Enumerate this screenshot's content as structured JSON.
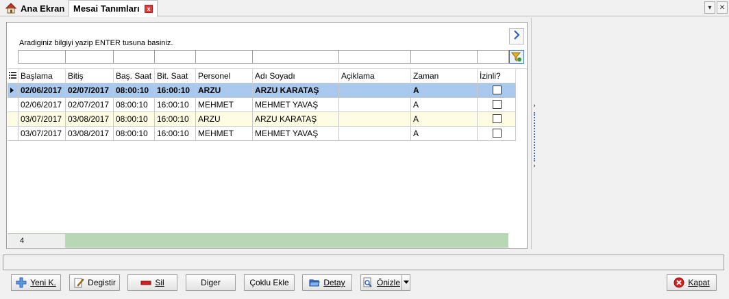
{
  "tabs": {
    "home_label": "Ana Ekran",
    "active_label": "Mesai Tanımları",
    "close_glyph": "x"
  },
  "window_controls": {
    "dropdown_glyph": "▾",
    "close_glyph": "✕"
  },
  "search": {
    "hint": "Aradiginiz bilgiyi yazip ENTER tusuna basiniz."
  },
  "grid": {
    "columns": [
      "Başlama",
      "Bitiş",
      "Baş. Saat",
      "Bit. Saat",
      "Personel",
      "Adı Soyadı",
      "Açiklama",
      "Zaman",
      "İzinli?"
    ],
    "rows": [
      [
        "02/06/2017",
        "02/07/2017",
        "08:00:10",
        "16:00:10",
        "ARZU",
        "ARZU KARATAŞ",
        "",
        "A"
      ],
      [
        "02/06/2017",
        "02/07/2017",
        "08:00:10",
        "16:00:10",
        "MEHMET",
        "MEHMET YAVAŞ",
        "",
        "A"
      ],
      [
        "03/07/2017",
        "03/08/2017",
        "08:00:10",
        "16:00:10",
        "ARZU",
        "ARZU KARATAŞ",
        "",
        "A"
      ],
      [
        "03/07/2017",
        "03/08/2017",
        "08:00:10",
        "16:00:10",
        "MEHMET",
        "MEHMET YAVAŞ",
        "",
        "A"
      ]
    ],
    "izinli": [
      false,
      false,
      false,
      false
    ],
    "selected_row": 0,
    "record_count": "4"
  },
  "buttons": {
    "yeni": "Yeni K.",
    "degistir": "Degistir",
    "sil": "Sil",
    "diger": "Diger",
    "coklu": "Çoklu Ekle",
    "detay": "Detay",
    "onizle": "Önizle",
    "kapat": "Kapat"
  },
  "colors": {
    "selected_row": "#a8c8ee",
    "alt_row": "#fdfbe2",
    "footer": "#b7d8b4",
    "accent": "#2a62b8"
  }
}
